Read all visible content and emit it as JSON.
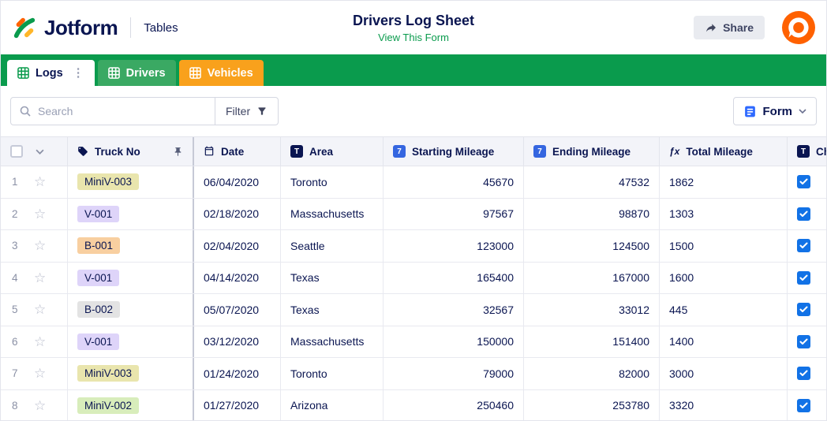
{
  "header": {
    "brand": "Jotform",
    "product": "Tables",
    "title": "Drivers Log Sheet",
    "view_form_link": "View This Form",
    "share_label": "Share"
  },
  "tabs": {
    "logs": "Logs",
    "drivers": "Drivers",
    "vehicles": "Vehicles"
  },
  "toolbar": {
    "search_placeholder": "Search",
    "filter_label": "Filter",
    "form_label": "Form"
  },
  "icons": {
    "dots_menu": "⋮",
    "star": "☆",
    "formula": "ƒx",
    "number_badge": "7",
    "text_badge": "T"
  },
  "colors": {
    "brand_green": "#0a9b4d",
    "tab_orange": "#f9a11c",
    "accent_blue": "#1272e6",
    "navy": "#0a1551",
    "avatar_orange": "#ff6100"
  },
  "table": {
    "columns": {
      "truck": "Truck No",
      "date": "Date",
      "area": "Area",
      "start": "Starting Mileage",
      "end": "Ending Mileage",
      "total": "Total Mileage",
      "checked": "Ch"
    },
    "rows": [
      {
        "num": "1",
        "truck": "MiniV-003",
        "badge_bg": "#e9e5ad",
        "date": "06/04/2020",
        "area": "Toronto",
        "start": "45670",
        "end": "47532",
        "total": "1862",
        "checked": true
      },
      {
        "num": "2",
        "truck": "V-001",
        "badge_bg": "#ded4f9",
        "date": "02/18/2020",
        "area": "Massachusetts",
        "start": "97567",
        "end": "98870",
        "total": "1303",
        "checked": true
      },
      {
        "num": "3",
        "truck": "B-001",
        "badge_bg": "#f8cfa0",
        "date": "02/04/2020",
        "area": "Seattle",
        "start": "123000",
        "end": "124500",
        "total": "1500",
        "checked": true
      },
      {
        "num": "4",
        "truck": "V-001",
        "badge_bg": "#ded4f9",
        "date": "04/14/2020",
        "area": "Texas",
        "start": "165400",
        "end": "167000",
        "total": "1600",
        "checked": true
      },
      {
        "num": "5",
        "truck": "B-002",
        "badge_bg": "#e3e3e3",
        "date": "05/07/2020",
        "area": "Texas",
        "start": "32567",
        "end": "33012",
        "total": "445",
        "checked": true
      },
      {
        "num": "6",
        "truck": "V-001",
        "badge_bg": "#ded4f9",
        "date": "03/12/2020",
        "area": "Massachusetts",
        "start": "150000",
        "end": "151400",
        "total": "1400",
        "checked": true
      },
      {
        "num": "7",
        "truck": "MiniV-003",
        "badge_bg": "#e9e5ad",
        "date": "01/24/2020",
        "area": "Toronto",
        "start": "79000",
        "end": "82000",
        "total": "3000",
        "checked": true
      },
      {
        "num": "8",
        "truck": "MiniV-002",
        "badge_bg": "#d8edbb",
        "date": "01/27/2020",
        "area": "Arizona",
        "start": "250460",
        "end": "253780",
        "total": "3320",
        "checked": true
      }
    ]
  }
}
